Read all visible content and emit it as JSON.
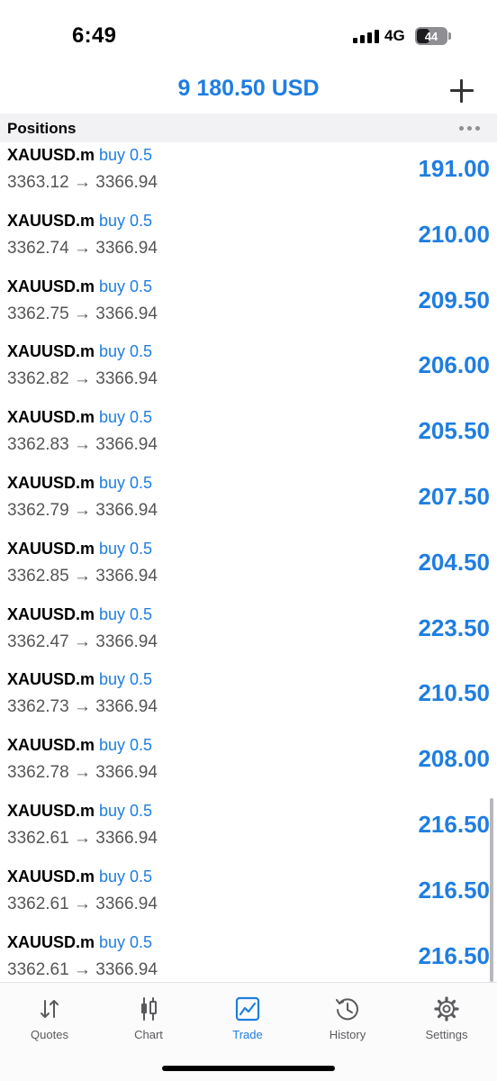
{
  "status_bar": {
    "time": "6:49",
    "network": "4G",
    "battery": "44",
    "battery_level": 0.44
  },
  "header": {
    "balance": "9 180.50 USD",
    "add_icon": "plus-icon"
  },
  "section": {
    "title": "Positions",
    "more_icon": "ellipsis-icon"
  },
  "positions": [
    {
      "symbol": "XAUUSD.m",
      "side": "buy 0.5",
      "open": "3363.12",
      "current": "3366.94",
      "profit": "191.00"
    },
    {
      "symbol": "XAUUSD.m",
      "side": "buy 0.5",
      "open": "3362.74",
      "current": "3366.94",
      "profit": "210.00"
    },
    {
      "symbol": "XAUUSD.m",
      "side": "buy 0.5",
      "open": "3362.75",
      "current": "3366.94",
      "profit": "209.50"
    },
    {
      "symbol": "XAUUSD.m",
      "side": "buy 0.5",
      "open": "3362.82",
      "current": "3366.94",
      "profit": "206.00"
    },
    {
      "symbol": "XAUUSD.m",
      "side": "buy 0.5",
      "open": "3362.83",
      "current": "3366.94",
      "profit": "205.50"
    },
    {
      "symbol": "XAUUSD.m",
      "side": "buy 0.5",
      "open": "3362.79",
      "current": "3366.94",
      "profit": "207.50"
    },
    {
      "symbol": "XAUUSD.m",
      "side": "buy 0.5",
      "open": "3362.85",
      "current": "3366.94",
      "profit": "204.50"
    },
    {
      "symbol": "XAUUSD.m",
      "side": "buy 0.5",
      "open": "3362.47",
      "current": "3366.94",
      "profit": "223.50"
    },
    {
      "symbol": "XAUUSD.m",
      "side": "buy 0.5",
      "open": "3362.73",
      "current": "3366.94",
      "profit": "210.50"
    },
    {
      "symbol": "XAUUSD.m",
      "side": "buy 0.5",
      "open": "3362.78",
      "current": "3366.94",
      "profit": "208.00"
    },
    {
      "symbol": "XAUUSD.m",
      "side": "buy 0.5",
      "open": "3362.61",
      "current": "3366.94",
      "profit": "216.50"
    },
    {
      "symbol": "XAUUSD.m",
      "side": "buy 0.5",
      "open": "3362.61",
      "current": "3366.94",
      "profit": "216.50"
    },
    {
      "symbol": "XAUUSD.m",
      "side": "buy 0.5",
      "open": "3362.61",
      "current": "3366.94",
      "profit": "216.50"
    }
  ],
  "tabs": [
    {
      "label": "Quotes",
      "icon": "quotes-arrows-icon",
      "active": false
    },
    {
      "label": "Chart",
      "icon": "candlestick-icon",
      "active": false
    },
    {
      "label": "Trade",
      "icon": "trade-chart-icon",
      "active": true
    },
    {
      "label": "History",
      "icon": "history-clock-icon",
      "active": false
    },
    {
      "label": "Settings",
      "icon": "gear-icon",
      "active": false
    }
  ],
  "colors": {
    "accent": "#1f7ee0",
    "text": "#000000",
    "secondary_text": "#555555",
    "section_bg": "#f2f2f4"
  }
}
